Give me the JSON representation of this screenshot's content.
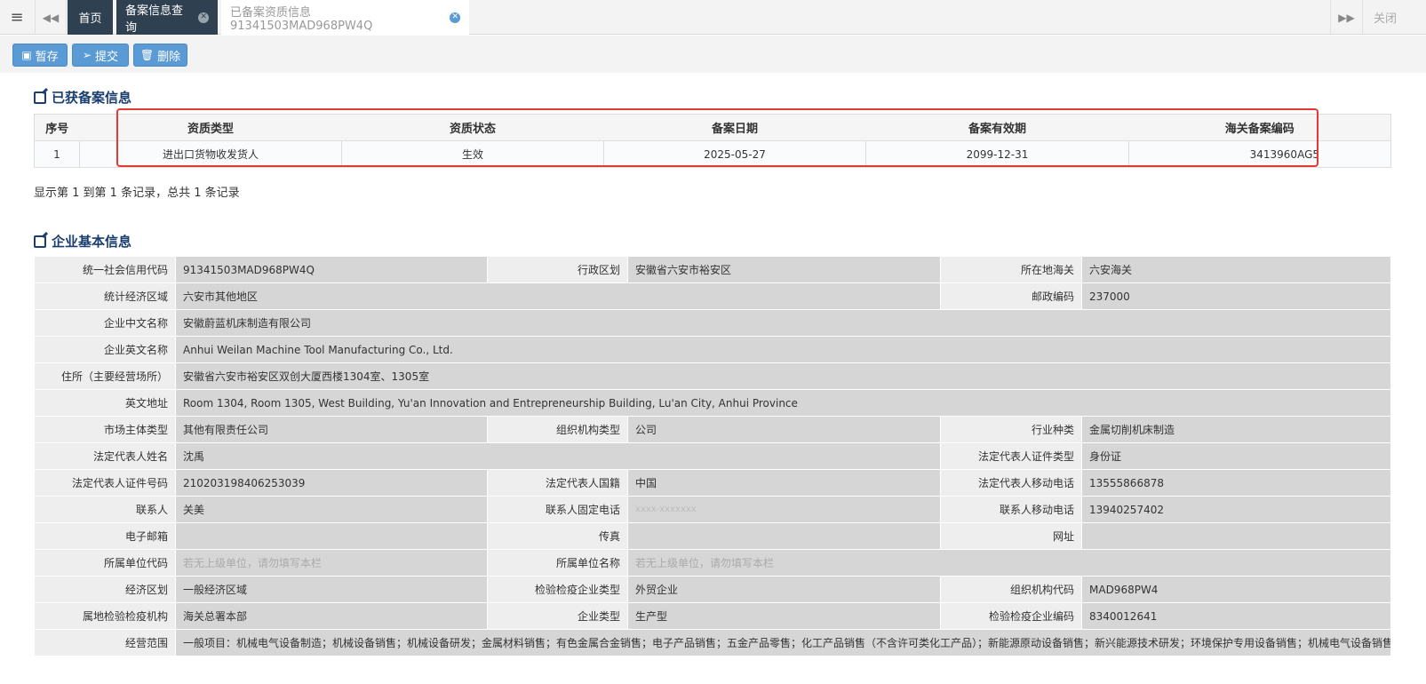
{
  "tabs": {
    "home": "首页",
    "query": "备案信息查询",
    "current": "已备案资质信息91341503MAD968PW4Q",
    "close_all": "关闭"
  },
  "toolbar": {
    "save": "暂存",
    "submit": "提交",
    "delete": "删除"
  },
  "records_section": {
    "title": "已获备案信息",
    "headers": [
      "序号",
      "资质类型",
      "资质状态",
      "备案日期",
      "备案有效期",
      "海关备案编码"
    ],
    "rows": [
      [
        "1",
        "进出口货物收发货人",
        "生效",
        "2025-05-27",
        "2099-12-31",
        "3413960AG5"
      ]
    ],
    "pager": "显示第 1 到第 1 条记录，总共 1 条记录"
  },
  "company_section": {
    "title": "企业基本信息",
    "uscc_label": "统一社会信用代码",
    "uscc": "91341503MAD968PW4Q",
    "region_label": "行政区划",
    "region": "安徽省六安市裕安区",
    "customs_label": "所在地海关",
    "customs": "六安海关",
    "econ_zone_label": "统计经济区域",
    "econ_zone": "六安市其他地区",
    "postcode_label": "邮政编码",
    "postcode": "237000",
    "name_cn_label": "企业中文名称",
    "name_cn": "安徽蔚蓝机床制造有限公司",
    "name_en_label": "企业英文名称",
    "name_en": "Anhui Weilan Machine Tool Manufacturing Co., Ltd.",
    "address_label": "住所（主要经营场所）",
    "address": "安徽省六安市裕安区双创大厦西楼1304室、1305室",
    "address_en_label": "英文地址",
    "address_en": "Room 1304, Room 1305, West Building, Yu'an Innovation and Entrepreneurship Building, Lu'an City, Anhui Province",
    "market_type_label": "市场主体类型",
    "market_type": "其他有限责任公司",
    "org_type_label": "组织机构类型",
    "org_type": "公司",
    "industry_label": "行业种类",
    "industry": "金属切削机床制造",
    "legal_name_label": "法定代表人姓名",
    "legal_name": "沈禹",
    "legal_id_type_label": "法定代表人证件类型",
    "legal_id_type": "身份证",
    "legal_id_label": "法定代表人证件号码",
    "legal_id": "210203198406253039",
    "legal_nat_label": "法定代表人国籍",
    "legal_nat": "中国",
    "legal_mobile_label": "法定代表人移动电话",
    "legal_mobile": "13555866878",
    "contact_label": "联系人",
    "contact": "关美",
    "contact_phone_label": "联系人固定电话",
    "contact_phone_ph": "xxxx-xxxxxxx",
    "contact_mobile_label": "联系人移动电话",
    "contact_mobile": "13940257402",
    "email_label": "电子邮箱",
    "email": "",
    "fax_label": "传真",
    "fax": "",
    "website_label": "网址",
    "website": "",
    "parent_code_label": "所属单位代码",
    "parent_code_ph": "若无上级单位，请勿填写本栏",
    "parent_name_label": "所属单位名称",
    "parent_name_ph": "若无上级单位，请勿填写本栏",
    "econ_region_label": "经济区划",
    "econ_region": "一般经济区域",
    "insp_type_label": "检验检疫企业类型",
    "insp_type": "外贸企业",
    "org_code_label": "组织机构代码",
    "org_code": "MAD968PW4",
    "insp_org_label": "属地检验检疫机构",
    "insp_org": "海关总署本部",
    "ent_type_label": "企业类型",
    "ent_type": "生产型",
    "insp_code_label": "检验检疫企业编码",
    "insp_code": "8340012641",
    "scope_label": "经营范围",
    "scope": "一般项目：机械电气设备制造；机械设备销售；机械设备研发；金属材料销售；有色金属合金销售；电子产品销售；五金产品零售；化工产品销售（不含许可类化工产品）；新能源原动设备销售；新兴能源技术研发；环境保护专用设备销售；机械电气设备销售；I"
  }
}
